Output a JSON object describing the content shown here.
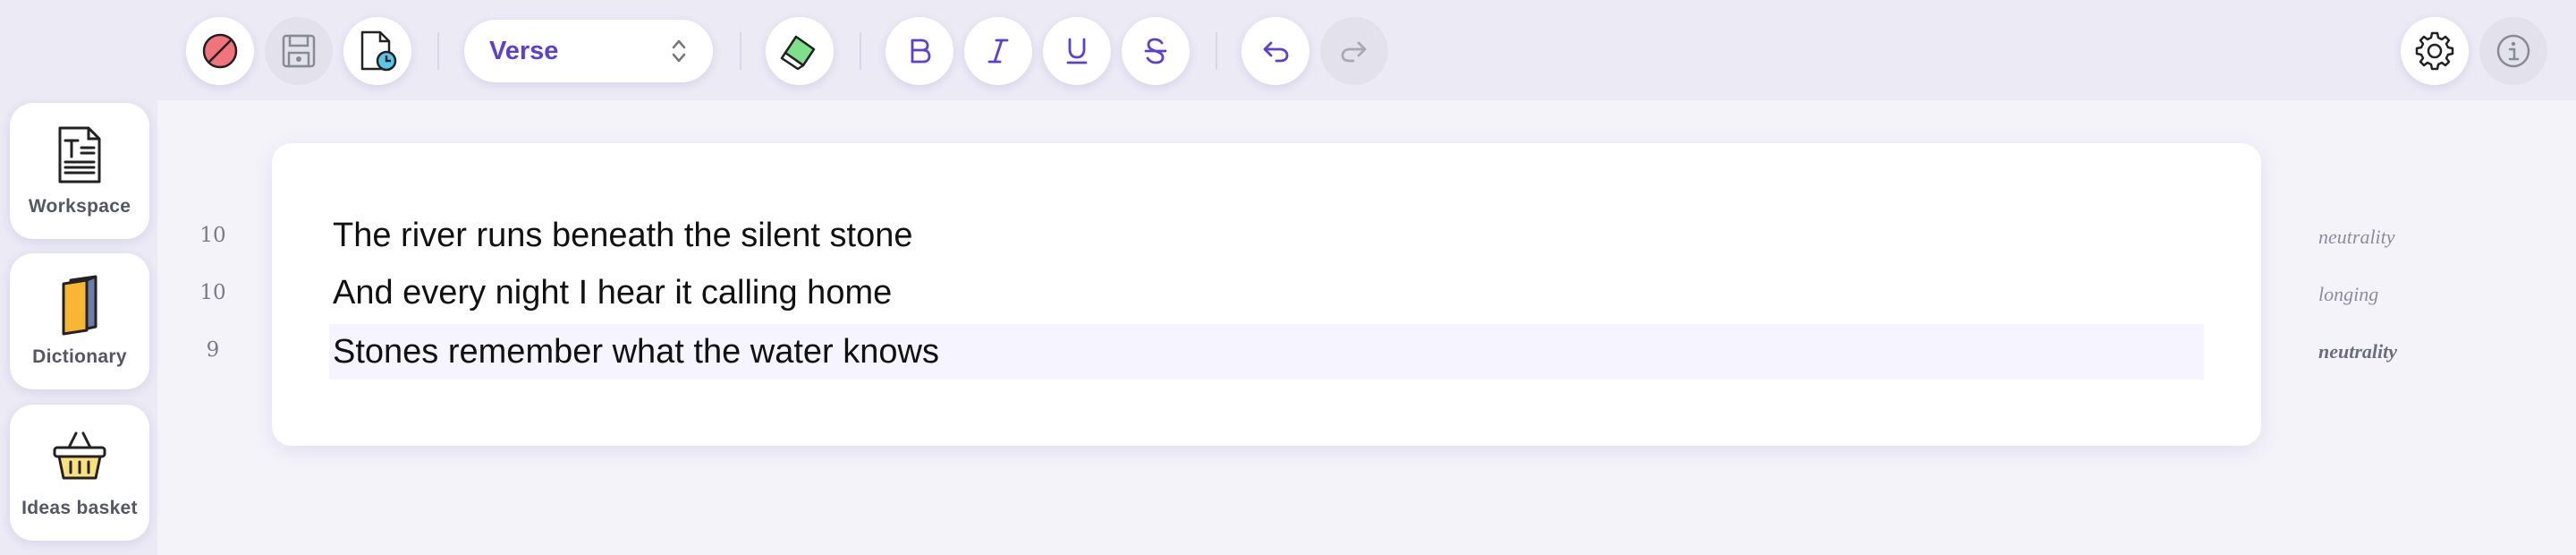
{
  "toolbar": {
    "buttons": [
      {
        "icon": "no-entry-icon"
      },
      {
        "icon": "floppy-disk-icon"
      },
      {
        "icon": "document-clock-icon"
      },
      {
        "icon": "eraser-icon"
      },
      {
        "icon": "bold-icon",
        "label": "B"
      },
      {
        "icon": "italic-icon",
        "label": "I"
      },
      {
        "icon": "underline-icon",
        "label": "U"
      },
      {
        "icon": "strikethrough-icon",
        "label": "S"
      },
      {
        "icon": "undo-icon"
      },
      {
        "icon": "redo-icon",
        "disabled": true
      },
      {
        "icon": "gear-icon"
      },
      {
        "icon": "info-icon",
        "disabled": true
      }
    ],
    "mode_select": {
      "value": "Verse"
    }
  },
  "sidebar": {
    "items": [
      {
        "label": "Workspace",
        "icon": "text-document-icon"
      },
      {
        "label": "Dictionary",
        "icon": "book-icon"
      },
      {
        "label": "Ideas basket",
        "icon": "basket-icon"
      }
    ]
  },
  "editor": {
    "lines": [
      {
        "text": "The river runs beneath the silent stone",
        "syllables": "10",
        "mood": "neutrality",
        "active": false
      },
      {
        "text": "And every night I hear it calling home",
        "syllables": "10",
        "mood": "longing",
        "active": false
      },
      {
        "text": "Stones remember what the water knows",
        "syllables": "9",
        "mood": "neutrality",
        "active": true
      }
    ]
  },
  "colors": {
    "accent": "#5a3fd8",
    "toolbar_bg": "#ebeaf5",
    "page_bg": "#f4f3fa",
    "active_line": "#f6f5ff"
  }
}
